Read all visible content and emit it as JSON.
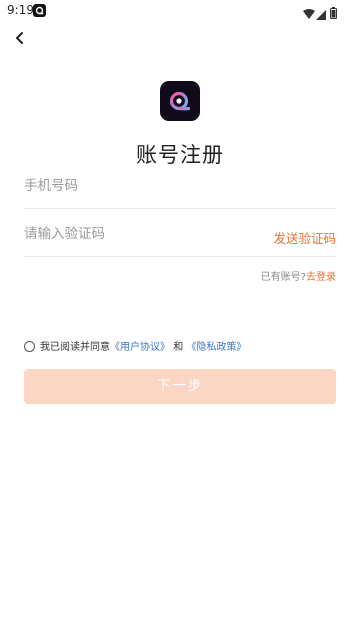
{
  "status_bar": {
    "time": "9:19",
    "icons": [
      "app-notification-icon",
      "wifi-icon",
      "signal-icon",
      "battery-icon"
    ]
  },
  "header": {
    "back_icon": "chevron-left-icon"
  },
  "logo": {
    "icon": "app-logo-icon",
    "background": "#100a1a",
    "gradient": [
      "#ff4f9a",
      "#4fc3ff"
    ]
  },
  "title": "账号注册",
  "form": {
    "phone": {
      "placeholder": "手机号码",
      "value": ""
    },
    "code": {
      "placeholder": "请输入验证码",
      "value": ""
    },
    "send_code_label": "发送验证码"
  },
  "login_hint": {
    "text": "已有账号?",
    "link": "去登录"
  },
  "agreement": {
    "checked": false,
    "prefix": "我已阅读并同意",
    "user_agreement": "《用户协议》",
    "conjunction": "和",
    "privacy_policy": "《隐私政策》"
  },
  "next_button": {
    "label": "下一步",
    "enabled": false
  },
  "colors": {
    "accent": "#e8743b",
    "link": "#3a78c9",
    "button_disabled": "#fbd6c4",
    "divider": "#e7e7e7",
    "placeholder": "#9a9a9a"
  }
}
